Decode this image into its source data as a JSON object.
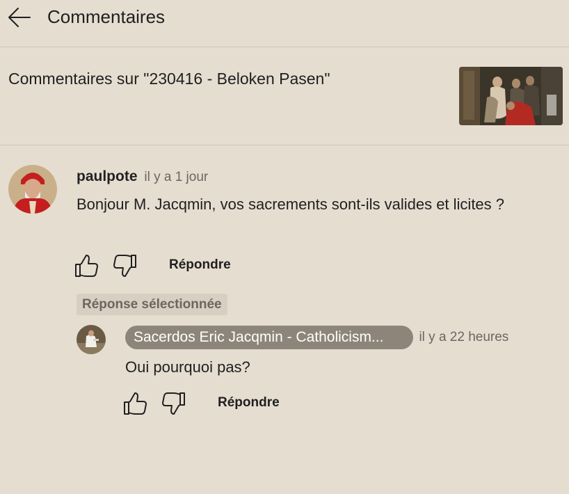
{
  "header": {
    "back_icon": "arrow-left-icon",
    "title": "Commentaires"
  },
  "video": {
    "title": "Commentaires sur \"230416 - Beloken Pasen\""
  },
  "comment": {
    "author": "paulpote",
    "time": "il y a 1 jour",
    "text": "Bonjour M. Jacqmin, vos sacrements sont-ils valides et licites ?",
    "like_icon": "thumbs-up-icon",
    "dislike_icon": "thumbs-down-icon",
    "reply_label": "Répondre"
  },
  "selected_label": "Réponse sélectionnée",
  "reply": {
    "author": "Sacerdos Eric Jacqmin - Catholicism...",
    "time": "il y a 22 heures",
    "text": "Oui pourquoi pas?",
    "like_icon": "thumbs-up-icon",
    "dislike_icon": "thumbs-down-icon",
    "reply_label": "Répondre"
  },
  "colors": {
    "background": "#e6ddd1",
    "divider": "#cfc6ba",
    "channel_chip": "#8e857a",
    "muted_text": "#6b6660"
  }
}
